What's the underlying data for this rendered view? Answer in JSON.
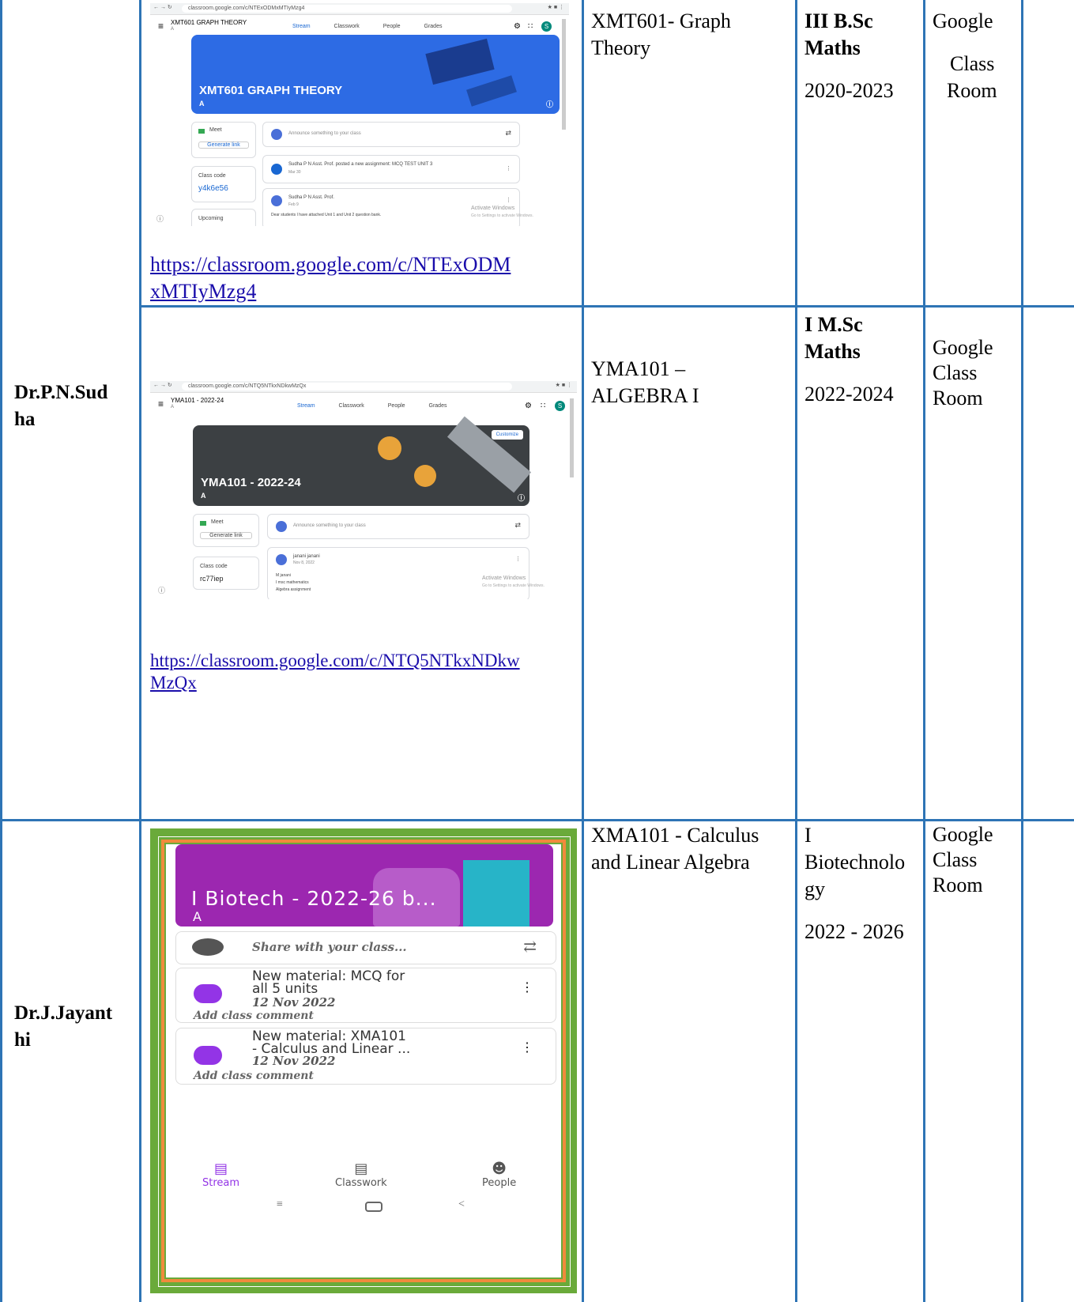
{
  "rows": [
    {
      "faculty": "",
      "screenshot": {
        "url": "classroom.google.com/c/NTExODMxMTIyMzg4",
        "class_name": "XMT601 GRAPH THEORY",
        "section": "A",
        "tabs": [
          "Stream",
          "Classwork",
          "People",
          "Grades"
        ],
        "banner_title": "XMT601 GRAPH THEORY",
        "banner_section": "A",
        "meet_label": "Meet",
        "generate_link": "Generate link",
        "class_code_label": "Class code",
        "class_code": "y4k6e56",
        "upcoming": "Upcoming",
        "announce_placeholder": "Announce something to your class",
        "post1": "Sudha P N Asst. Prof. posted a new assignment: MCQ TEST UNIT 3",
        "post1_date": "Mar 30",
        "post2_author": "Sudha P N Asst. Prof.",
        "post2_date": "Feb 9",
        "post2_text": "Dear students I have attached Unit 1 and Unit 2 question bank.",
        "activate1": "Activate Windows",
        "activate2": "Go to Settings to activate Windows."
      },
      "link_line1": "https://classroom.google.com/c/NTExODM",
      "link_line2": "xMTIyMzg4",
      "course_line1": "XMT601- Graph",
      "course_line2": "Theory",
      "class_line1": "III B.Sc",
      "class_line2": "Maths",
      "years": "2020-2023",
      "platform_line1": "Google",
      "platform_line2": "Class",
      "platform_line3": "Room"
    },
    {
      "faculty_line1": "Dr.P.N.Sud",
      "faculty_line2": "ha",
      "screenshot": {
        "url": "classroom.google.com/c/NTQ5NTkxNDkwMzQx",
        "class_name": "YMA101 - 2022-24",
        "section": "A",
        "tabs": [
          "Stream",
          "Classwork",
          "People",
          "Grades"
        ],
        "customize": "Customize",
        "banner_title": "YMA101 - 2022-24",
        "banner_section": "A",
        "meet_label": "Meet",
        "generate_link": "Generate link",
        "class_code_label": "Class code",
        "class_code": "rc77iep",
        "announce_placeholder": "Announce something to your class",
        "post_author": "janani janani",
        "post_date": "Nov 8, 2022",
        "post_line1": "M janani",
        "post_line2": "I msc mathematics",
        "post_line3": "Algebra assignment",
        "activate1": "Activate Windows",
        "activate2": "Go to Settings to activate Windows."
      },
      "link_line1": "https://classroom.google.com/c/NTQ5NTkxNDkw",
      "link_line2": "MzQx",
      "course_line1": "YMA101 –",
      "course_line2": "ALGEBRA I",
      "class_line1": "I M.Sc",
      "class_line2": "Maths",
      "years": "2022-2024",
      "platform_line1": "Google",
      "platform_line2": "Class",
      "platform_line3": "Room"
    },
    {
      "faculty_line1": "Dr.J.Jayant",
      "faculty_line2": "hi",
      "screenshot": {
        "banner_title": "I Biotech - 2022-26 b...",
        "banner_section": "A",
        "share_placeholder": "Share with your class...",
        "post1_line1": "New material: MCQ for",
        "post1_line2": "all 5 units",
        "post1_date": "12 Nov 2022",
        "post2_line1": "New material: XMA101",
        "post2_line2": "- Calculus and Linear ...",
        "post2_date": "12 Nov 2022",
        "add_comment": "Add class comment",
        "nav_stream": "Stream",
        "nav_classwork": "Classwork",
        "nav_people": "People"
      },
      "course_line1": "XMA101 - Calculus",
      "course_line2": "and Linear Algebra",
      "class_line1": "I",
      "class_line2": "Biotechnolo",
      "class_line3": "gy",
      "years": "2022 - 2026",
      "platform_line1": "Google",
      "platform_line2": "Class",
      "platform_line3": "Room"
    }
  ],
  "colors": {
    "grid": "#2e74b5",
    "link": "#1a0dab",
    "gc_blue": "#1967d2",
    "banner_blue": "#2d6be4",
    "banner_dark": "#3c4043",
    "banner_purple": "#9c27b0",
    "frame_green": "#6aaa3a",
    "frame_orange": "#f08a3c"
  }
}
